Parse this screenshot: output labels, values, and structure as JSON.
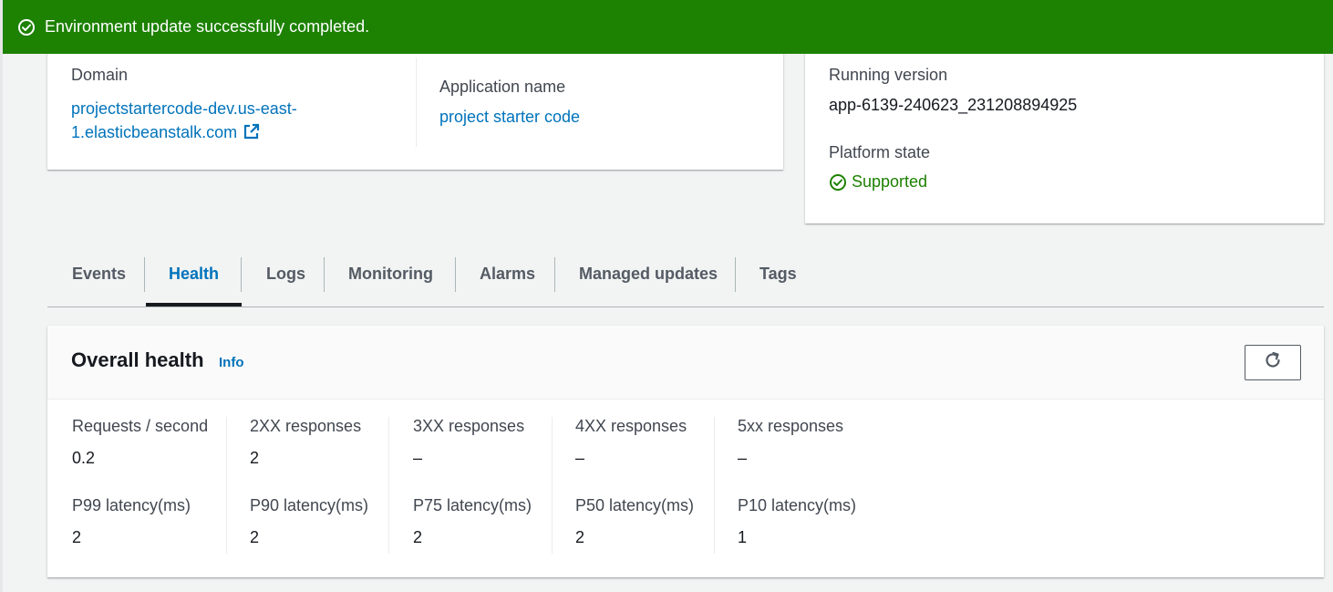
{
  "flash": {
    "message": "Environment update successfully completed.",
    "icon": "check-circle-icon",
    "color": "#1d8102"
  },
  "details": {
    "domain_label": "Domain",
    "domain_line1": "projectstartercode-dev.us-east-",
    "domain_line2": "1.elasticbeanstalk.com",
    "app_name_label": "Application name",
    "app_name_value": "project starter code"
  },
  "running": {
    "version_label": "Running version",
    "version_value": "app-6139-240623_231208894925",
    "platform_state_label": "Platform state",
    "platform_state_value": "Supported"
  },
  "tabs": [
    {
      "label": "Events",
      "active": false
    },
    {
      "label": "Health",
      "active": true
    },
    {
      "label": "Logs",
      "active": false
    },
    {
      "label": "Monitoring",
      "active": false
    },
    {
      "label": "Alarms",
      "active": false
    },
    {
      "label": "Managed updates",
      "active": false
    },
    {
      "label": "Tags",
      "active": false
    }
  ],
  "health": {
    "title": "Overall health",
    "info_label": "Info",
    "refresh_icon": "refresh-icon",
    "metrics": [
      {
        "label": "Requests / second",
        "value": "0.2"
      },
      {
        "label": "2XX responses",
        "value": "2"
      },
      {
        "label": "3XX responses",
        "value": "–"
      },
      {
        "label": "4XX responses",
        "value": "–"
      },
      {
        "label": "5xx responses",
        "value": "–"
      }
    ],
    "latencies": [
      {
        "label": "P99 latency(ms)",
        "value": "2"
      },
      {
        "label": "P90 latency(ms)",
        "value": "2"
      },
      {
        "label": "P75 latency(ms)",
        "value": "2"
      },
      {
        "label": "P50 latency(ms)",
        "value": "2"
      },
      {
        "label": "P10 latency(ms)",
        "value": "1"
      }
    ]
  },
  "colors": {
    "link": "#0073bb",
    "success": "#1d8102",
    "background": "#f2f3f3"
  }
}
